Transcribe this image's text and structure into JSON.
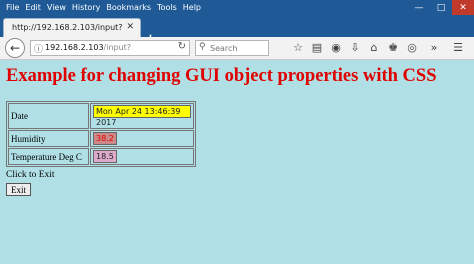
{
  "menu": [
    "File",
    "Edit",
    "View",
    "History",
    "Bookmarks",
    "Tools",
    "Help"
  ],
  "tab": {
    "title": "http://192.168.2.103/input?"
  },
  "address": {
    "host": "192.168.2.103",
    "path": "/input?"
  },
  "search": {
    "placeholder": "Search"
  },
  "page": {
    "heading": "Example for changing GUI object properties with CSS",
    "rows": [
      {
        "label": "Date",
        "value": "Mon Apr 24 13:46:39 2017"
      },
      {
        "label": "Humidity",
        "value": "38.2"
      },
      {
        "label": "Temperature Deg C",
        "value": "18.5"
      }
    ],
    "exit_label": "Click to Exit",
    "exit_button": "Exit"
  },
  "colors": {
    "page_bg": "#b0e0e6",
    "heading": "#e00000",
    "date_bg": "#ffff00",
    "humidity_bg": "#cc8888",
    "humidity_text": "#e00000",
    "temp_bg": "#ddaacc"
  }
}
